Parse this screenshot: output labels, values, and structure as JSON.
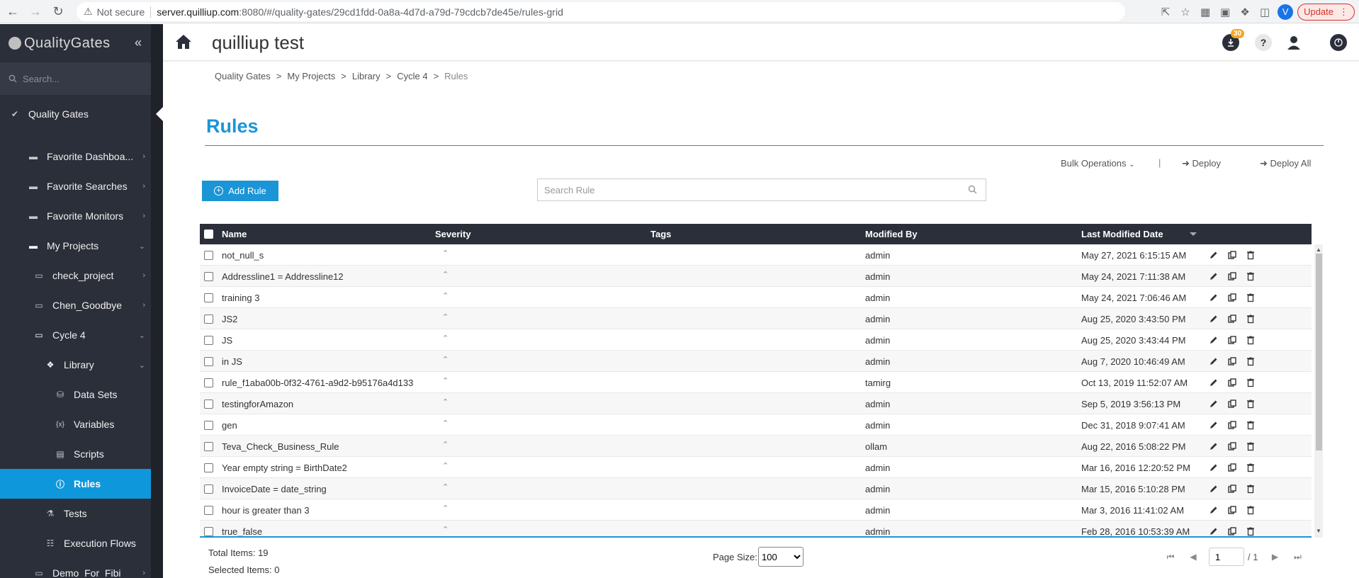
{
  "browser": {
    "not_secure": "Not secure",
    "url_host": "server.quilliup.com",
    "url_path": ":8080/#/quality-gates/29cd1fdd-0a8a-4d7d-a79d-79cdcb7de45e/rules-grid",
    "profile_initial": "V",
    "update_label": "Update"
  },
  "sidebar": {
    "logo": "QualityGates",
    "search_placeholder": "Search...",
    "items": [
      {
        "label": "Quality Gates",
        "icon": "check-icon"
      },
      {
        "label": "Favorite Dashboa...",
        "icon": "folder-icon"
      },
      {
        "label": "Favorite Searches",
        "icon": "folder-icon"
      },
      {
        "label": "Favorite Monitors",
        "icon": "folder-icon"
      },
      {
        "label": "My Projects",
        "icon": "folder-icon"
      },
      {
        "label": "check_project",
        "icon": "folder-open-icon"
      },
      {
        "label": "Chen_Goodbye",
        "icon": "folder-open-icon"
      },
      {
        "label": "Cycle 4",
        "icon": "folder-open-icon"
      },
      {
        "label": "Library",
        "icon": "library-icon"
      },
      {
        "label": "Data Sets",
        "icon": "database-icon"
      },
      {
        "label": "Variables",
        "icon": "variables-icon"
      },
      {
        "label": "Scripts",
        "icon": "script-icon"
      },
      {
        "label": "Rules",
        "icon": "rule-icon"
      },
      {
        "label": "Tests",
        "icon": "flask-icon"
      },
      {
        "label": "Execution Flows",
        "icon": "flow-icon"
      },
      {
        "label": "Demo_For_Fibi",
        "icon": "folder-open-icon"
      }
    ]
  },
  "header": {
    "title": "quilliup test",
    "notification_count": "30",
    "help": "?"
  },
  "breadcrumb": [
    "Quality Gates",
    ">",
    "My Projects",
    ">",
    "Library",
    ">",
    "Cycle 4",
    ">",
    "Rules"
  ],
  "page": {
    "title": "Rules",
    "bulk_label": "Bulk Operations",
    "pipe": "|",
    "deploy_label": "Deploy",
    "deploy_all_label": "Deploy All",
    "add_rule_label": "Add Rule",
    "search_placeholder": "Search Rule"
  },
  "table": {
    "columns": [
      "Name",
      "Severity",
      "Tags",
      "Modified By",
      "Last Modified Date"
    ],
    "rows": [
      {
        "name": "not_null_s",
        "severity": "⌃",
        "tags": "",
        "modified_by": "admin",
        "date": "May 27, 2021 6:15:15 AM"
      },
      {
        "name": "Addressline1 = Addressline12",
        "severity": "⌃",
        "tags": "",
        "modified_by": "admin",
        "date": "May 24, 2021 7:11:38 AM"
      },
      {
        "name": "training 3",
        "severity": "⌃",
        "tags": "",
        "modified_by": "admin",
        "date": "May 24, 2021 7:06:46 AM"
      },
      {
        "name": "JS2",
        "severity": "⌃",
        "tags": "",
        "modified_by": "admin",
        "date": "Aug 25, 2020 3:43:50 PM"
      },
      {
        "name": "JS",
        "severity": "⌃",
        "tags": "",
        "modified_by": "admin",
        "date": "Aug 25, 2020 3:43:44 PM"
      },
      {
        "name": "in JS",
        "severity": "⌃",
        "tags": "",
        "modified_by": "admin",
        "date": "Aug 7, 2020 10:46:49 AM"
      },
      {
        "name": "rule_f1aba00b-0f32-4761-a9d2-b95176a4d133",
        "severity": "⌃",
        "tags": "",
        "modified_by": "tamirg",
        "date": "Oct 13, 2019 11:52:07 AM"
      },
      {
        "name": "testingforAmazon",
        "severity": "⌃",
        "tags": "",
        "modified_by": "admin",
        "date": "Sep 5, 2019 3:56:13 PM"
      },
      {
        "name": "gen",
        "severity": "⌃",
        "tags": "",
        "modified_by": "admin",
        "date": "Dec 31, 2018 9:07:41 AM"
      },
      {
        "name": "Teva_Check_Business_Rule",
        "severity": "⌃",
        "tags": "",
        "modified_by": "ollam",
        "date": "Aug 22, 2016 5:08:22 PM"
      },
      {
        "name": "Year empty string = BirthDate2",
        "severity": "⌃",
        "tags": "",
        "modified_by": "admin",
        "date": "Mar 16, 2016 12:20:52 PM"
      },
      {
        "name": "InvoiceDate = date_string",
        "severity": "⌃",
        "tags": "",
        "modified_by": "admin",
        "date": "Mar 15, 2016 5:10:28 PM"
      },
      {
        "name": "hour is greater than 3",
        "severity": "⌃",
        "tags": "",
        "modified_by": "admin",
        "date": "Mar 3, 2016 11:41:02 AM"
      },
      {
        "name": "true_false",
        "severity": "⌃",
        "tags": "",
        "modified_by": "admin",
        "date": "Feb 28, 2016 10:53:39 AM"
      }
    ]
  },
  "footer": {
    "total_items": "Total Items: 19",
    "selected_items": "Selected Items: 0",
    "page_size_label": "Page Size:",
    "page_size_value": "100",
    "page_current": "1",
    "page_of": "/ 1"
  },
  "colors": {
    "accent": "#1b95d6",
    "sidebar_bg": "#2b2f3a",
    "badge": "#f5a623"
  }
}
